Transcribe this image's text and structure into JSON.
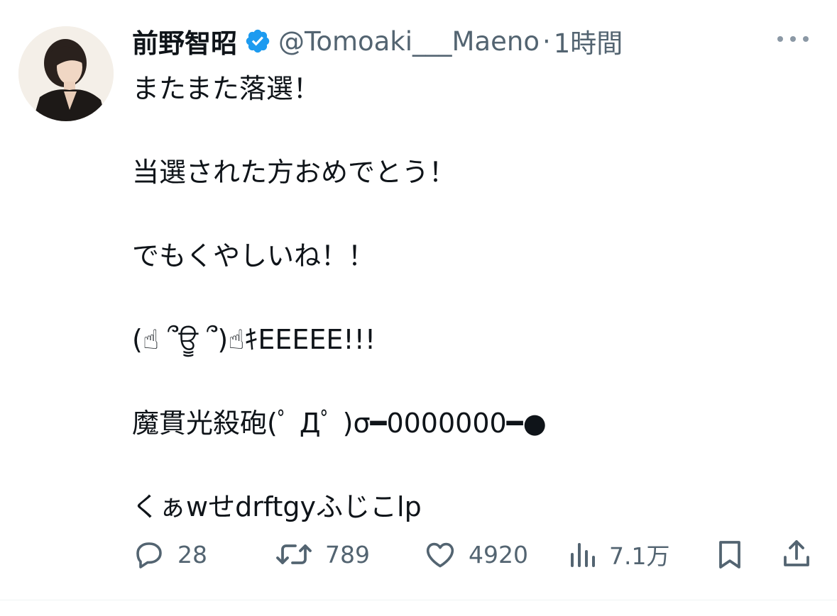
{
  "author": {
    "display_name": "前野智昭",
    "handle": "@Tomoaki___Maeno",
    "separator": "·",
    "time": "1時間",
    "verified": true,
    "verified_color": "#1d9bf0"
  },
  "tweet": {
    "lines": [
      "またまた落選！",
      "当選された方おめでとう！",
      "でもくやしいね！！",
      "(☝ ՞ਊ ՞)☝ｷEEEEE!!!",
      "魔貫光殺砲(ﾟ Дﾟ )σ━0000000━●",
      "くぁwせdrftgyふじこlp"
    ]
  },
  "actions": {
    "reply": {
      "icon": "reply-icon",
      "count": "28"
    },
    "retweet": {
      "icon": "retweet-icon",
      "count": "789"
    },
    "like": {
      "icon": "heart-icon",
      "count": "4920"
    },
    "views": {
      "icon": "views-icon",
      "count": "7.1万"
    },
    "bookmark": {
      "icon": "bookmark-icon"
    },
    "share": {
      "icon": "share-icon"
    }
  },
  "colors": {
    "text": "#0f1419",
    "secondary": "#536471",
    "divider": "#eff3f4"
  }
}
